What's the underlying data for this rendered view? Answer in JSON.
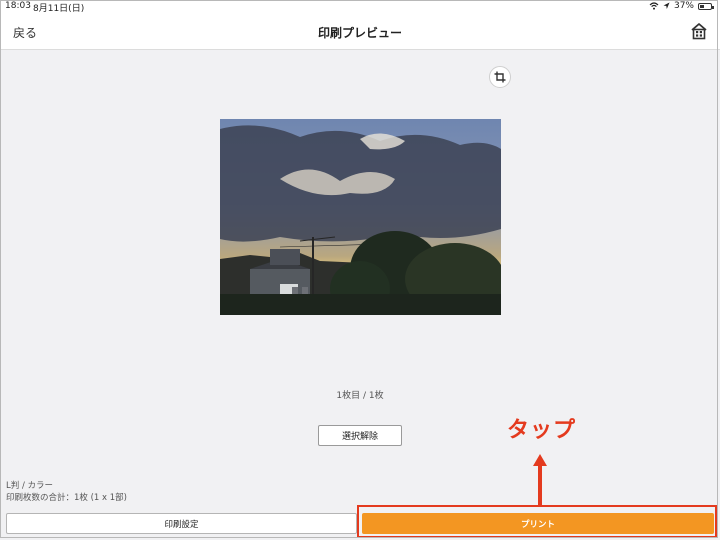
{
  "statusbar": {
    "time": "18:03",
    "date": "8月11日(日)",
    "battery": "37%"
  },
  "navbar": {
    "back_label": "戻る",
    "title": "印刷プレビュー"
  },
  "preview": {
    "page_counter": "1枚目 / 1枚"
  },
  "deselect_label": "選択解除",
  "annotation": {
    "tap_label": "タップ",
    "color": "#e43a1e"
  },
  "info": {
    "paper_mode": "L判 / カラー",
    "total_label": "印刷枚数の合計：1枚 (1 x 1部)"
  },
  "bottom": {
    "settings_label": "印刷設定",
    "print_label": "プリント",
    "print_color": "#f39622"
  },
  "icons": {
    "home": "home-icon",
    "crop": "crop-icon",
    "wifi": "wifi-icon",
    "location": "location-icon",
    "battery": "battery-icon"
  }
}
